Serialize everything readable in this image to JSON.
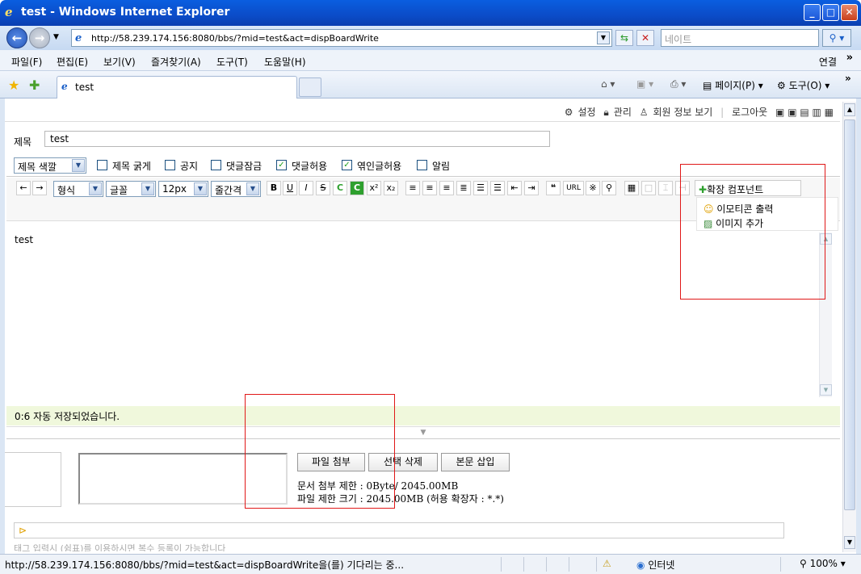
{
  "window": {
    "title": "test - Windows Internet Explorer"
  },
  "address": {
    "url": "http://58.239.174.156:8080/bbs/?mid=test&act=dispBoardWrite",
    "search_placeholder": "네이트"
  },
  "menu": {
    "items": [
      "파일(F)",
      "편집(E)",
      "보기(V)",
      "즐겨찾기(A)",
      "도구(T)",
      "도움말(H)"
    ],
    "links": "연결"
  },
  "tab": {
    "label": "test"
  },
  "commands": {
    "page": "페이지(P)",
    "tools": "도구(O)"
  },
  "page": {
    "top_links": [
      "설정",
      "관리",
      "회원 정보 보기",
      "로그아웃"
    ],
    "title_label": "제목",
    "title_value": "test",
    "title_color_select": "제목 색깔",
    "options": [
      {
        "label": "제목 굵게",
        "checked": false
      },
      {
        "label": "공지",
        "checked": false
      },
      {
        "label": "댓글잠금",
        "checked": false
      },
      {
        "label": "댓글허용",
        "checked": true
      },
      {
        "label": "엮인글허용",
        "checked": true
      },
      {
        "label": "알림",
        "checked": false
      }
    ],
    "format_select": "형식",
    "font_select": "글꼴",
    "size_select": "12px",
    "linespacing_select": "줄간격",
    "ext_component": "확장 컴포넌트",
    "ext_menu": [
      "이모티콘 출력",
      "이미지 추가"
    ],
    "editor_content": "test",
    "autosave_text": "0:6 자동 저장되었습니다.",
    "buttons": {
      "attach": "파일 첨부",
      "delete": "선택 삭제",
      "insert": "본문 삽입"
    },
    "limit_doc": "문서 첨부 제한 : 0Byte/ 2045.00MB",
    "limit_file": "파일 제한 크기 : 2045.00MB (허용 확장자 : *.*)",
    "tag_hint": "태그 입력시 (쉼표)를 이용하시면 복수 등록이 가능합니다"
  },
  "status": {
    "text": "http://58.239.174.156:8080/bbs/?mid=test&act=dispBoardWrite을(를) 기다리는 중...",
    "zone": "인터넷",
    "zoom": "100%"
  },
  "colors": {
    "highlight_box": "#e01818",
    "autosave_bg": "#f0f8dc"
  }
}
